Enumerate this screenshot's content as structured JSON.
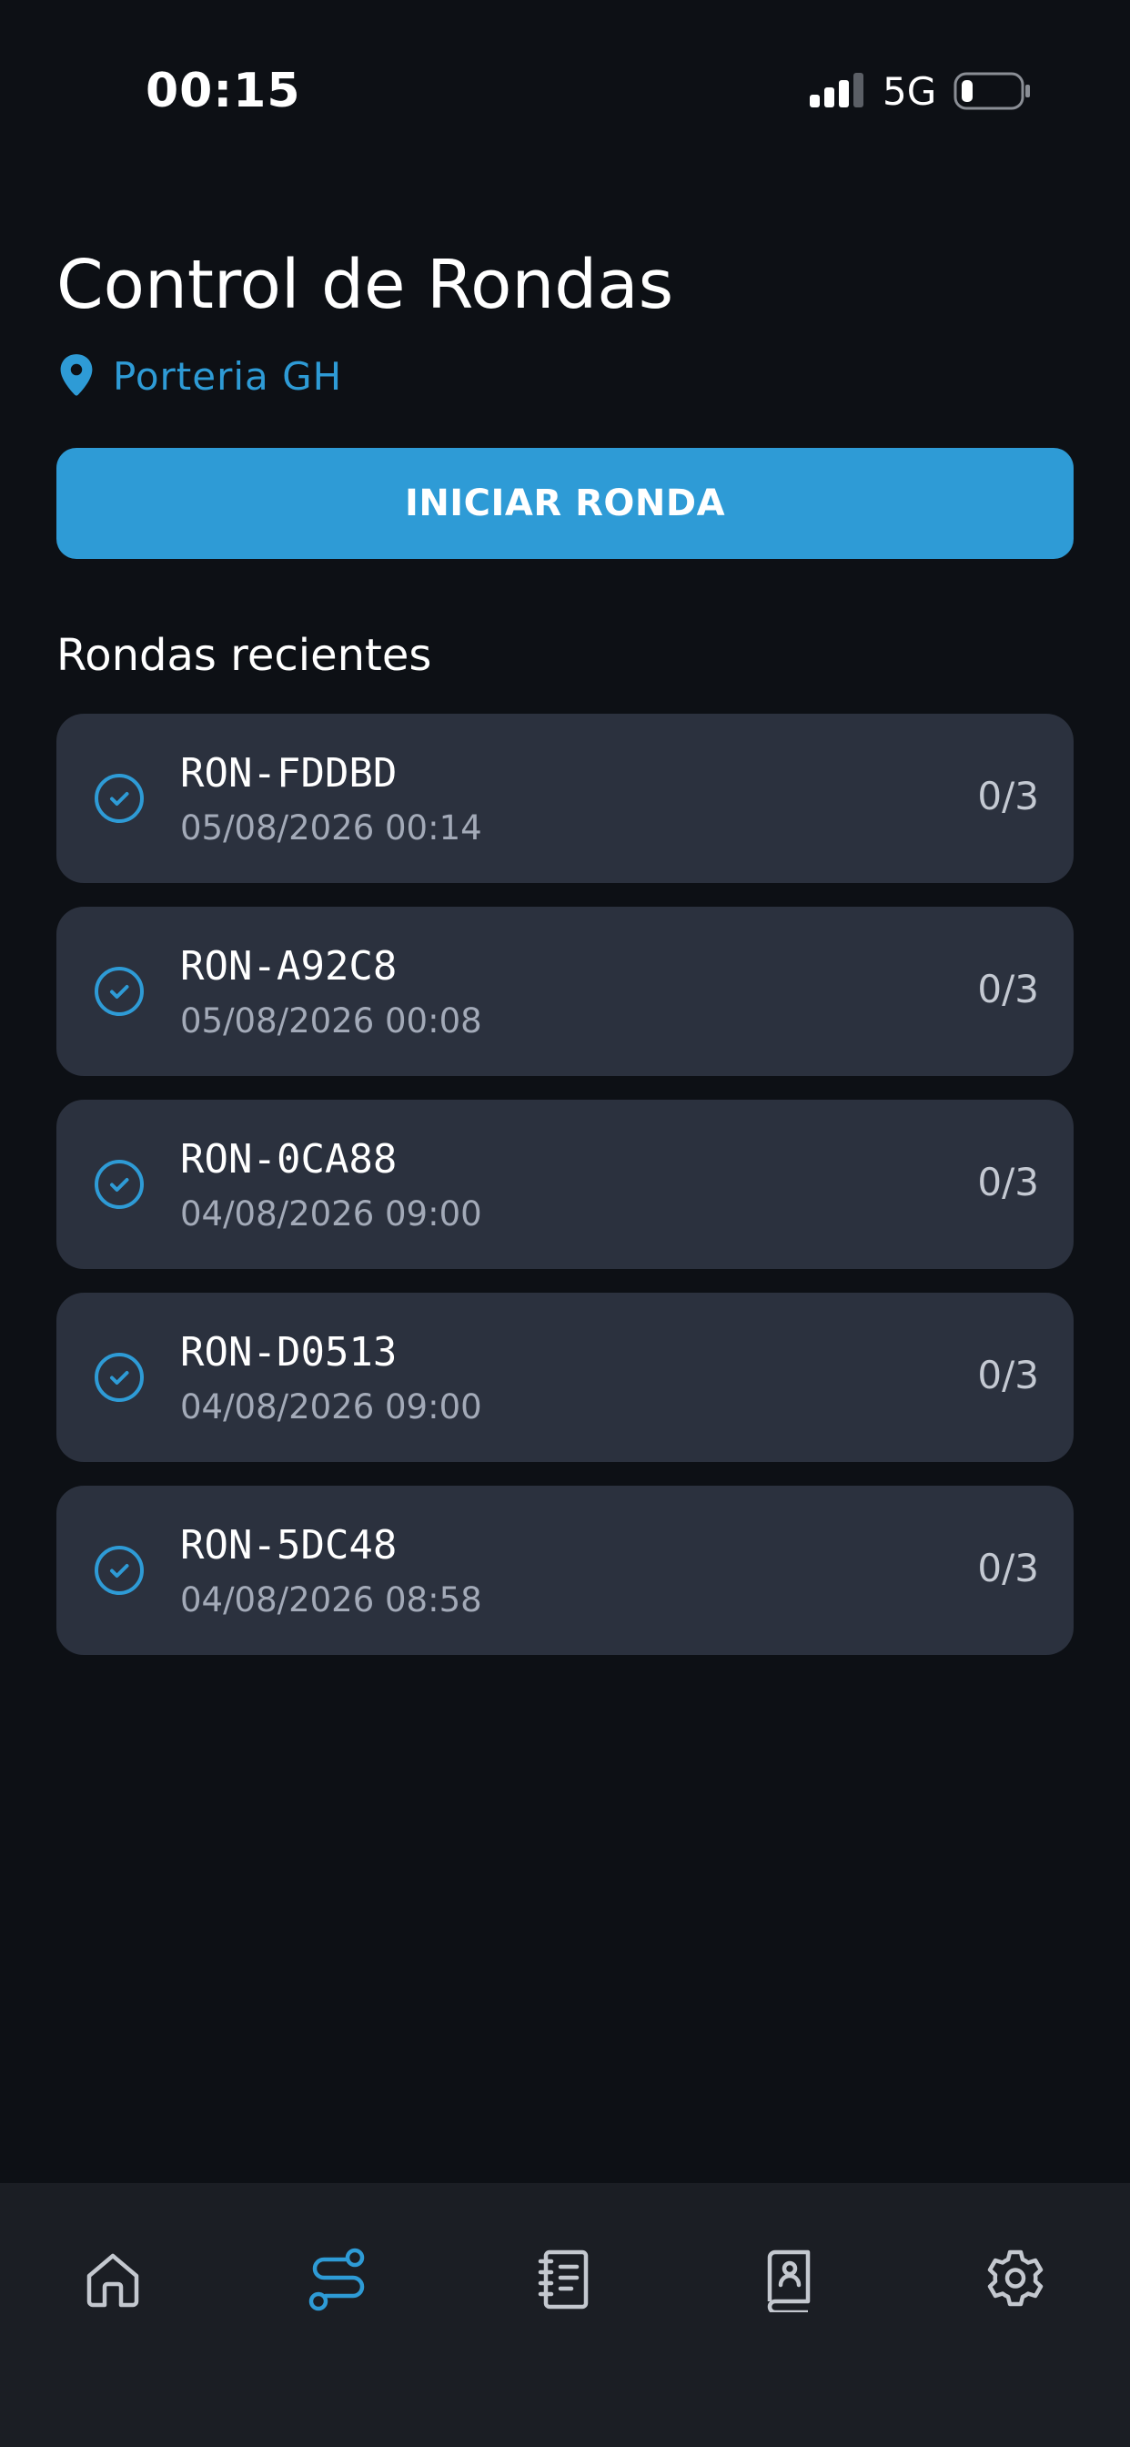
{
  "status_bar": {
    "time": "00:15",
    "network": "5G"
  },
  "header": {
    "title": "Control de Rondas",
    "location": "Porteria GH"
  },
  "actions": {
    "start_label": "INICIAR RONDA"
  },
  "recent": {
    "title": "Rondas recientes",
    "rounds": [
      {
        "id": "RON-FDDBD",
        "date": "05/08/2026 00:14",
        "progress": "0/3"
      },
      {
        "id": "RON-A92C8",
        "date": "05/08/2026 00:08",
        "progress": "0/3"
      },
      {
        "id": "RON-0CA88",
        "date": "04/08/2026 09:00",
        "progress": "0/3"
      },
      {
        "id": "RON-D0513",
        "date": "04/08/2026 09:00",
        "progress": "0/3"
      },
      {
        "id": "RON-5DC48",
        "date": "04/08/2026 08:58",
        "progress": "0/3"
      }
    ]
  },
  "nav": {
    "items": [
      {
        "icon": "home-icon",
        "active": false
      },
      {
        "icon": "route-icon",
        "active": true
      },
      {
        "icon": "notebook-icon",
        "active": false
      },
      {
        "icon": "contacts-book-icon",
        "active": false
      },
      {
        "icon": "gear-icon",
        "active": false
      }
    ]
  },
  "colors": {
    "background": "#0d1015",
    "accent": "#2e9bd6",
    "card": "#2b313e",
    "nav_background": "#1b1e24",
    "muted_text": "#a3aab8"
  }
}
